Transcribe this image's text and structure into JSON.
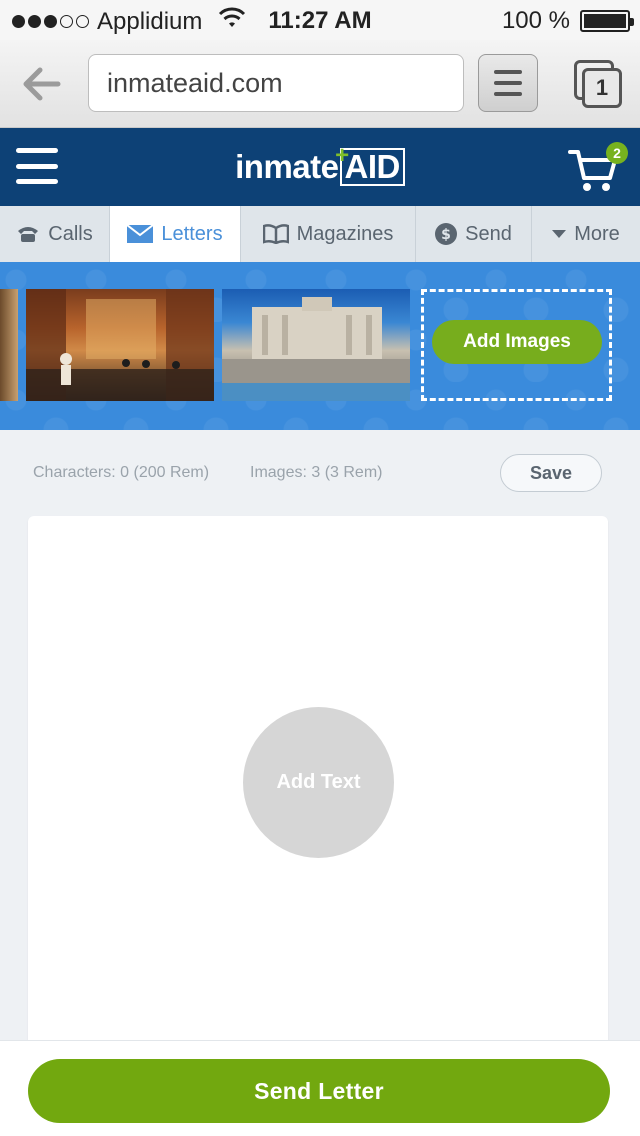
{
  "status_bar": {
    "carrier": "Applidium",
    "time": "11:27 AM",
    "battery": "100 %"
  },
  "browser": {
    "url": "inmateaid.com",
    "tab_count": "1"
  },
  "header": {
    "logo_text": "inmate",
    "logo_box_text": "AID",
    "logo_plus": "+",
    "cart_count": "2",
    "colors": {
      "header_bg": "#0d4176",
      "accent": "#77b21f"
    }
  },
  "nav": {
    "tabs": [
      {
        "label": "Calls",
        "icon": "phone-icon"
      },
      {
        "label": "Letters",
        "icon": "envelope-icon",
        "active": true
      },
      {
        "label": "Magazines",
        "icon": "book-icon"
      },
      {
        "label": "Send",
        "icon": "dollar-icon"
      },
      {
        "label": "More",
        "icon": "caret-down-icon"
      }
    ]
  },
  "images": {
    "add_label": "Add Images"
  },
  "info": {
    "characters": "Characters: 0 (200 Rem)",
    "images": "Images: 3 (3 Rem)",
    "save_label": "Save"
  },
  "letter": {
    "add_text_label": "Add Text"
  },
  "footer": {
    "send_label": "Send Letter"
  }
}
